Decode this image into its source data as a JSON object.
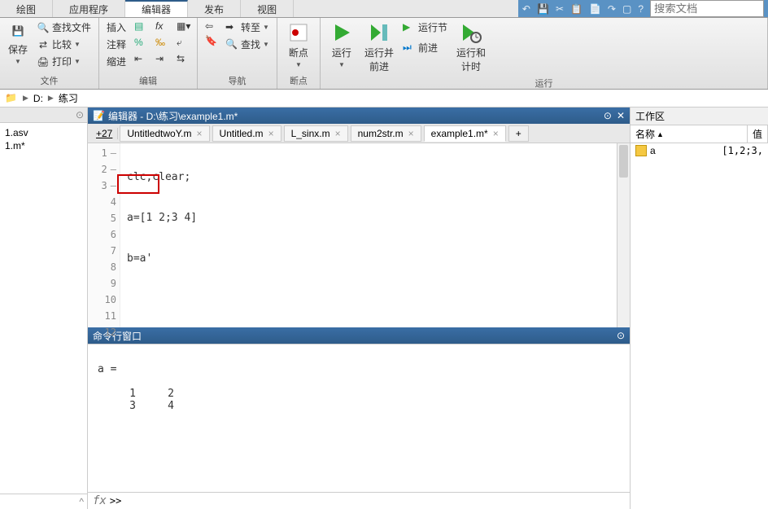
{
  "top_tabs": {
    "tab1": "绘图",
    "tab2": "应用程序",
    "tab3": "编辑器",
    "tab4": "发布",
    "tab5": "视图"
  },
  "search_placeholder": "搜索文档",
  "ribbon": {
    "file_group": "文件",
    "save": "保存",
    "find_files": "查找文件",
    "compare": "比较",
    "print": "打印",
    "edit_group": "编辑",
    "insert": "插入",
    "comment": "注释",
    "indent": "缩进",
    "nav_group": "导航",
    "goto": "转至",
    "find": "查找",
    "bp_group": "断点",
    "breakpoints": "断点",
    "run_group": "运行",
    "run": "运行",
    "run_advance": "运行并\n前进",
    "run_section": "运行节",
    "advance": "前进",
    "run_time": "运行和\n计时"
  },
  "addr": {
    "drive": "D:",
    "folder": "练习"
  },
  "files": {
    "f1": "1.asv",
    "f2": "1.m*"
  },
  "editor": {
    "title": "编辑器 - D:\\练习\\example1.m*",
    "zoom": "+27",
    "tabs": {
      "t1": "UntitledtwoY.m",
      "t2": "Untitled.m",
      "t3": "L_sinx.m",
      "t4": "num2str.m",
      "t5": "example1.m*"
    },
    "lines": {
      "l1": "clc;clear;",
      "l2": "a=[1 2;3 4]",
      "l3": "b=a'"
    }
  },
  "cmd": {
    "title": "命令行窗口",
    "output": "\na =\n\n     1     2\n     3     4\n",
    "prompt": ">>"
  },
  "workspace": {
    "title": "工作区",
    "col_name": "名称",
    "col_value": "值",
    "var_name": "a",
    "var_value": "[1,2;3,"
  },
  "chart_data": {
    "type": "table",
    "title": "a (matrix variable)",
    "rows": [
      [
        1,
        2
      ],
      [
        3,
        4
      ]
    ]
  }
}
